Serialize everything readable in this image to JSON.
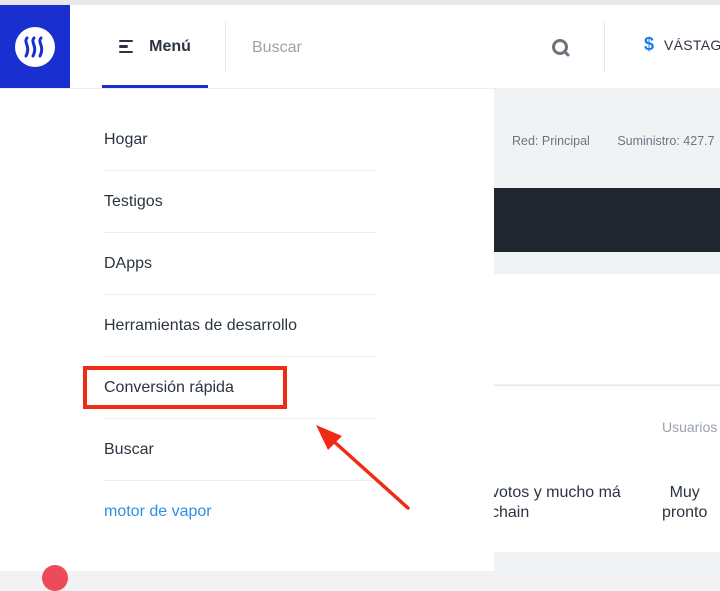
{
  "header": {
    "menu_label": "Menú",
    "search_placeholder": "Buscar",
    "currency_symbol": "$",
    "currency_label": "VÁSTAGO",
    "accent_color": "#1a2fd0"
  },
  "main": {
    "network_label": "Red: Principal",
    "supply_label": "Suministro: 427.7",
    "users_label": "Usuarios",
    "description_line1": "votos y mucho má",
    "description_line2": "chain",
    "soon_line1": "Muy",
    "soon_line2": "pronto"
  },
  "menu": {
    "items": [
      {
        "label": "Hogar"
      },
      {
        "label": "Testigos"
      },
      {
        "label": "DApps"
      },
      {
        "label": "Herramientas de desarrollo"
      },
      {
        "label": "Conversión rápida"
      },
      {
        "label": "Buscar"
      },
      {
        "label": "motor de vapor"
      }
    ]
  },
  "annotation": {
    "highlight_color": "#ef2b13",
    "highlighted_item": "Conversión rápida"
  },
  "icons": {
    "logo": "steem-logo-icon",
    "menu": "hamburger-menu-icon",
    "search": "search-icon",
    "currency": "dollar-icon"
  }
}
